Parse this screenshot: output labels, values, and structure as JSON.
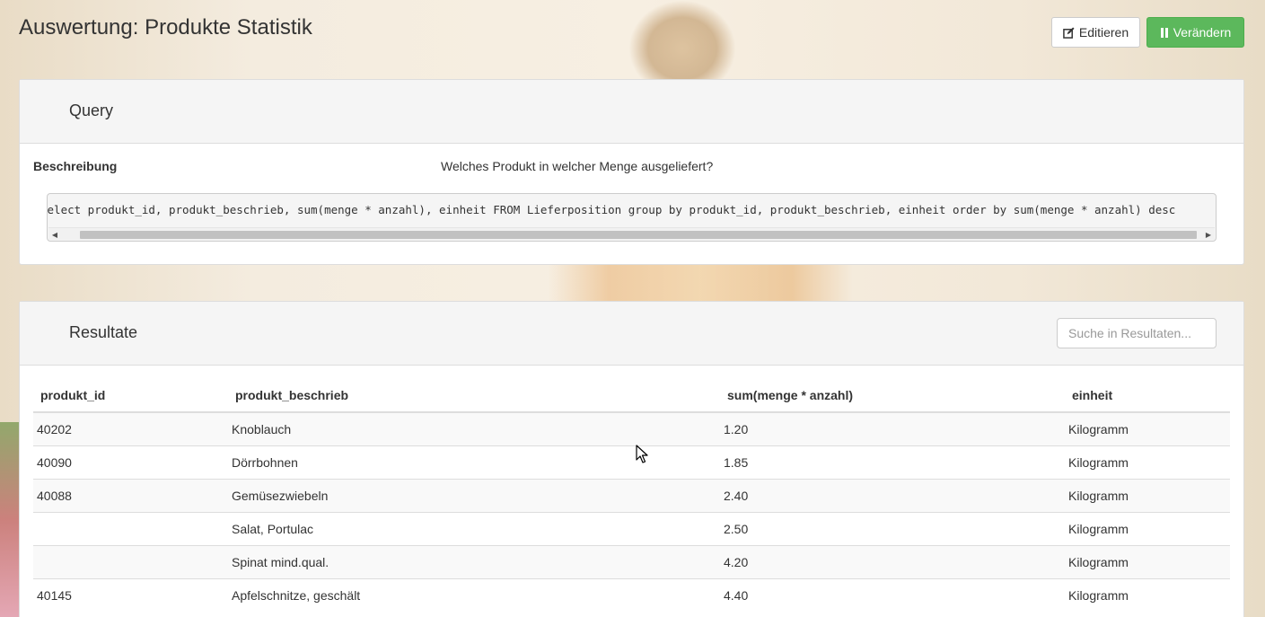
{
  "page": {
    "title": "Auswertung: Produkte Statistik"
  },
  "toolbar": {
    "edit_label": "Editieren",
    "change_label": "Verändern",
    "edit_icon": "edit-icon",
    "change_icon": "pause-icon",
    "change_color": "#5cb85c"
  },
  "query": {
    "title": "Query",
    "description_label": "Beschreibung",
    "description_value": "Welches Produkt in welcher Menge ausgeliefert?",
    "sql": "select produkt_id, produkt_beschrieb, sum(menge * anzahl), einheit FROM Lieferposition group by produkt_id, produkt_beschrieb, einheit order by sum(menge * anzahl) desc"
  },
  "results": {
    "title": "Resultate",
    "search_placeholder": "Suche in Resultaten...",
    "columns": [
      "produkt_id",
      "produkt_beschrieb",
      "sum(menge * anzahl)",
      "einheit"
    ],
    "rows": [
      {
        "produkt_id": "40202",
        "produkt_beschrieb": "Knoblauch",
        "sum": "1.20",
        "einheit": "Kilogramm"
      },
      {
        "produkt_id": "40090",
        "produkt_beschrieb": "Dörrbohnen",
        "sum": "1.85",
        "einheit": "Kilogramm"
      },
      {
        "produkt_id": "40088",
        "produkt_beschrieb": "Gemüsezwiebeln",
        "sum": "2.40",
        "einheit": "Kilogramm"
      },
      {
        "produkt_id": "",
        "produkt_beschrieb": "Salat, Portulac",
        "sum": "2.50",
        "einheit": "Kilogramm"
      },
      {
        "produkt_id": "",
        "produkt_beschrieb": "Spinat mind.qual.",
        "sum": "4.20",
        "einheit": "Kilogramm"
      },
      {
        "produkt_id": "40145",
        "produkt_beschrieb": "Apfelschnitze, geschält",
        "sum": "4.40",
        "einheit": "Kilogramm"
      }
    ]
  }
}
